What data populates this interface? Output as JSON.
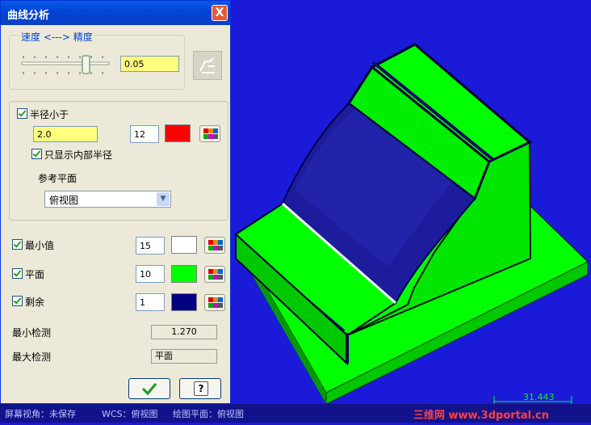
{
  "dialog": {
    "title": "曲线分析",
    "close_label": "X",
    "speed_precision": {
      "legend": "速度 <---> 精度",
      "value": "0.05",
      "slider_level": 0.75
    },
    "radius_section": {
      "checkbox_label": "半径小于",
      "radius_value": "2.0",
      "count_value": "12",
      "color": "#ff0000",
      "inner_only_label": "只显示内部半径",
      "ref_plane_label": "参考平面",
      "ref_plane_value": "俯视图"
    },
    "min_row": {
      "label": "最小值",
      "count": "15",
      "color": "#ffffff"
    },
    "flat_row": {
      "label": "平面",
      "count": "10",
      "color": "#00ff00"
    },
    "rest_row": {
      "label": "剩余",
      "count": "1",
      "color": "#000080"
    },
    "min_check": {
      "label": "最小检测",
      "value": "1.270"
    },
    "max_check": {
      "label": "最大检测",
      "value": "平面"
    },
    "ok_icon": "checkmark-icon",
    "help_icon": "question-icon"
  },
  "status_bar": {
    "seg1": "屏幕视角：未保存",
    "seg2": "WCS：俯视图",
    "seg3": "绘图平面：俯视图"
  },
  "scale_bar": {
    "value": "31.443"
  },
  "watermark": "三维网 www.3dportal.cn",
  "colors": {
    "viewport_bg": "#1a1ad8",
    "part_green": "#00ff00",
    "curved_face": "#1c1c9c",
    "dialog_bg": "#ece9d8"
  }
}
